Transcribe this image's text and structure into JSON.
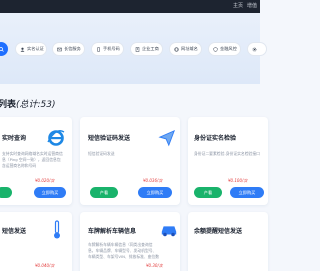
{
  "topbar": {
    "link1": "主页",
    "link2": "增值"
  },
  "nav": {
    "items": [
      {
        "label": "",
        "icon": "search-icon"
      },
      {
        "label": "实名认证",
        "icon": "user-icon"
      },
      {
        "label": "长信服务",
        "icon": "mail-icon"
      },
      {
        "label": "手机号码",
        "icon": "phone-icon"
      },
      {
        "label": "企业工商",
        "icon": "building-icon"
      },
      {
        "label": "网址域名",
        "icon": "globe-icon"
      },
      {
        "label": "金融风控",
        "icon": "shield-icon"
      },
      {
        "label": "",
        "icon": "gear-icon"
      }
    ]
  },
  "section": {
    "title": "列表",
    "count": "(总计:53)"
  },
  "cards": [
    {
      "title": "实时查询",
      "desc": "支持实时查询网络域名实时运营商信息（Ping 空间一致），返回信息包含运营商名称和号码",
      "price": "¥0.020/次",
      "btn_detail": "立即购买",
      "btn_buy": "",
      "icon": "ie-icon"
    },
    {
      "title": "短信验证码发送",
      "desc": "短信验证码发送",
      "price": "¥0.036/次",
      "btn_detail": "立即购买",
      "btn_buy": "产看",
      "icon": "send-icon"
    },
    {
      "title": "身份证实名检验",
      "desc": "身份证二要素检验-身份证实名检验接口",
      "price": "¥0.100/次",
      "btn_detail": "立即购买",
      "btn_buy": "产看",
      "icon": "id-card-icon"
    },
    {
      "title": "短信发送",
      "desc": "",
      "price": "¥0.040/次",
      "btn_detail": "",
      "btn_buy": "",
      "icon": "thermometer-icon"
    },
    {
      "title": "车牌解析车辆信息",
      "desc": "车牌解析车辆车辆信息（同类出查询信息，车辆品牌、车辆型号、发动机型号、车辆类型、车架号VIN、排放标准、座位数等）",
      "price": "¥0.30/次",
      "btn_detail": "",
      "btn_buy": "",
      "icon": "car-icon"
    },
    {
      "title": "余额提醒短信发送",
      "desc": "",
      "price": "",
      "btn_detail": "",
      "btn_buy": "",
      "icon": "bell-icon"
    }
  ]
}
